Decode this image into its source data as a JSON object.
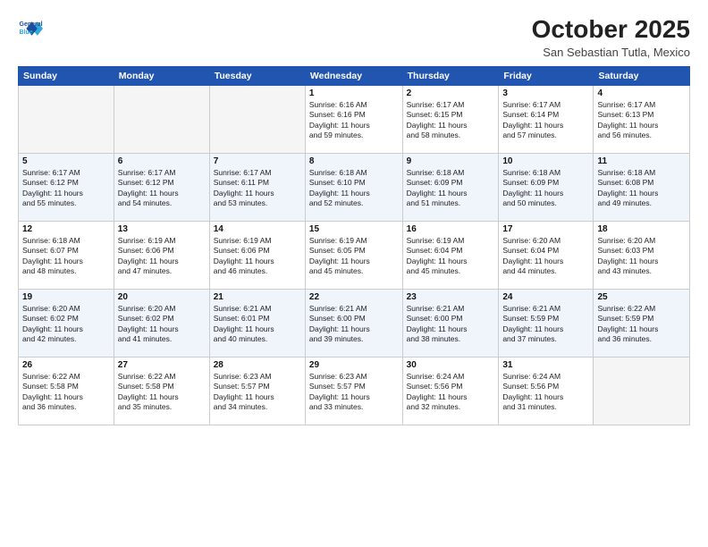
{
  "header": {
    "logo_line1": "General",
    "logo_line2": "Blue",
    "month": "October 2025",
    "location": "San Sebastian Tutla, Mexico"
  },
  "weekdays": [
    "Sunday",
    "Monday",
    "Tuesday",
    "Wednesday",
    "Thursday",
    "Friday",
    "Saturday"
  ],
  "weeks": [
    [
      {
        "day": "",
        "info": ""
      },
      {
        "day": "",
        "info": ""
      },
      {
        "day": "",
        "info": ""
      },
      {
        "day": "1",
        "info": "Sunrise: 6:16 AM\nSunset: 6:16 PM\nDaylight: 11 hours\nand 59 minutes."
      },
      {
        "day": "2",
        "info": "Sunrise: 6:17 AM\nSunset: 6:15 PM\nDaylight: 11 hours\nand 58 minutes."
      },
      {
        "day": "3",
        "info": "Sunrise: 6:17 AM\nSunset: 6:14 PM\nDaylight: 11 hours\nand 57 minutes."
      },
      {
        "day": "4",
        "info": "Sunrise: 6:17 AM\nSunset: 6:13 PM\nDaylight: 11 hours\nand 56 minutes."
      }
    ],
    [
      {
        "day": "5",
        "info": "Sunrise: 6:17 AM\nSunset: 6:12 PM\nDaylight: 11 hours\nand 55 minutes."
      },
      {
        "day": "6",
        "info": "Sunrise: 6:17 AM\nSunset: 6:12 PM\nDaylight: 11 hours\nand 54 minutes."
      },
      {
        "day": "7",
        "info": "Sunrise: 6:17 AM\nSunset: 6:11 PM\nDaylight: 11 hours\nand 53 minutes."
      },
      {
        "day": "8",
        "info": "Sunrise: 6:18 AM\nSunset: 6:10 PM\nDaylight: 11 hours\nand 52 minutes."
      },
      {
        "day": "9",
        "info": "Sunrise: 6:18 AM\nSunset: 6:09 PM\nDaylight: 11 hours\nand 51 minutes."
      },
      {
        "day": "10",
        "info": "Sunrise: 6:18 AM\nSunset: 6:09 PM\nDaylight: 11 hours\nand 50 minutes."
      },
      {
        "day": "11",
        "info": "Sunrise: 6:18 AM\nSunset: 6:08 PM\nDaylight: 11 hours\nand 49 minutes."
      }
    ],
    [
      {
        "day": "12",
        "info": "Sunrise: 6:18 AM\nSunset: 6:07 PM\nDaylight: 11 hours\nand 48 minutes."
      },
      {
        "day": "13",
        "info": "Sunrise: 6:19 AM\nSunset: 6:06 PM\nDaylight: 11 hours\nand 47 minutes."
      },
      {
        "day": "14",
        "info": "Sunrise: 6:19 AM\nSunset: 6:06 PM\nDaylight: 11 hours\nand 46 minutes."
      },
      {
        "day": "15",
        "info": "Sunrise: 6:19 AM\nSunset: 6:05 PM\nDaylight: 11 hours\nand 45 minutes."
      },
      {
        "day": "16",
        "info": "Sunrise: 6:19 AM\nSunset: 6:04 PM\nDaylight: 11 hours\nand 45 minutes."
      },
      {
        "day": "17",
        "info": "Sunrise: 6:20 AM\nSunset: 6:04 PM\nDaylight: 11 hours\nand 44 minutes."
      },
      {
        "day": "18",
        "info": "Sunrise: 6:20 AM\nSunset: 6:03 PM\nDaylight: 11 hours\nand 43 minutes."
      }
    ],
    [
      {
        "day": "19",
        "info": "Sunrise: 6:20 AM\nSunset: 6:02 PM\nDaylight: 11 hours\nand 42 minutes."
      },
      {
        "day": "20",
        "info": "Sunrise: 6:20 AM\nSunset: 6:02 PM\nDaylight: 11 hours\nand 41 minutes."
      },
      {
        "day": "21",
        "info": "Sunrise: 6:21 AM\nSunset: 6:01 PM\nDaylight: 11 hours\nand 40 minutes."
      },
      {
        "day": "22",
        "info": "Sunrise: 6:21 AM\nSunset: 6:00 PM\nDaylight: 11 hours\nand 39 minutes."
      },
      {
        "day": "23",
        "info": "Sunrise: 6:21 AM\nSunset: 6:00 PM\nDaylight: 11 hours\nand 38 minutes."
      },
      {
        "day": "24",
        "info": "Sunrise: 6:21 AM\nSunset: 5:59 PM\nDaylight: 11 hours\nand 37 minutes."
      },
      {
        "day": "25",
        "info": "Sunrise: 6:22 AM\nSunset: 5:59 PM\nDaylight: 11 hours\nand 36 minutes."
      }
    ],
    [
      {
        "day": "26",
        "info": "Sunrise: 6:22 AM\nSunset: 5:58 PM\nDaylight: 11 hours\nand 36 minutes."
      },
      {
        "day": "27",
        "info": "Sunrise: 6:22 AM\nSunset: 5:58 PM\nDaylight: 11 hours\nand 35 minutes."
      },
      {
        "day": "28",
        "info": "Sunrise: 6:23 AM\nSunset: 5:57 PM\nDaylight: 11 hours\nand 34 minutes."
      },
      {
        "day": "29",
        "info": "Sunrise: 6:23 AM\nSunset: 5:57 PM\nDaylight: 11 hours\nand 33 minutes."
      },
      {
        "day": "30",
        "info": "Sunrise: 6:24 AM\nSunset: 5:56 PM\nDaylight: 11 hours\nand 32 minutes."
      },
      {
        "day": "31",
        "info": "Sunrise: 6:24 AM\nSunset: 5:56 PM\nDaylight: 11 hours\nand 31 minutes."
      },
      {
        "day": "",
        "info": ""
      }
    ]
  ]
}
